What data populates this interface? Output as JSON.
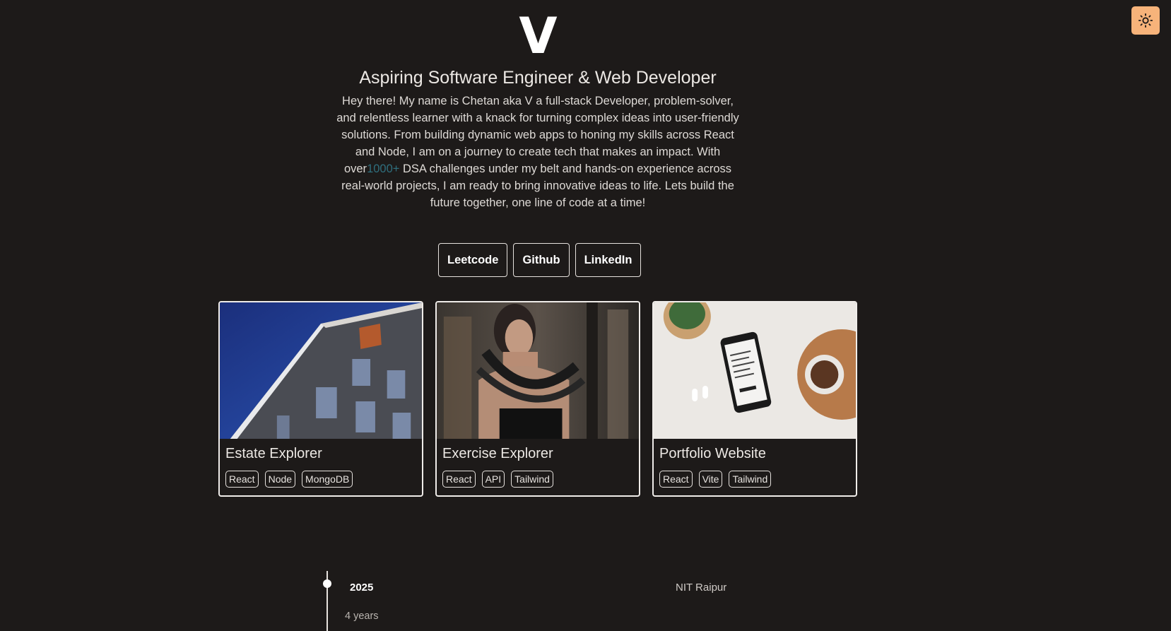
{
  "theme_toggle": {
    "icon": "sun-icon",
    "color": "#f7b37a"
  },
  "hero": {
    "logo": "V",
    "tagline": "Aspiring Software Engineer & Web Developer",
    "intro_before": "Hey there! My name is Chetan aka V a full-stack Developer, problem-solver, and relentless learner with a knack for turning complex ideas into user-friendly solutions. From building dynamic web apps to honing my skills across React and Node, I am on a journey to create tech that makes an impact. With over",
    "intro_highlight": "1000+",
    "intro_after": " DSA challenges under my belt and hands-on experience across real-world projects, I am ready to bring innovative ideas to life. Lets build the future together, one line of code at a time!"
  },
  "links": [
    {
      "label": "Leetcode"
    },
    {
      "label": "Github"
    },
    {
      "label": "LinkedIn"
    }
  ],
  "projects": [
    {
      "title": "Estate Explorer",
      "image": "building-photo",
      "tags": [
        "React",
        "Node",
        "MongoDB"
      ]
    },
    {
      "title": "Exercise Explorer",
      "image": "fitness-photo",
      "tags": [
        "React",
        "API",
        "Tailwind"
      ]
    },
    {
      "title": "Portfolio Website",
      "image": "desk-phone-photo",
      "tags": [
        "React",
        "Vite",
        "Tailwind"
      ]
    }
  ],
  "timeline": {
    "year": "2025",
    "duration": "4 years",
    "organization": "NIT Raipur"
  },
  "colors": {
    "background": "#1d1a19",
    "accent": "#2f6f7e",
    "toggle": "#f7b37a"
  }
}
